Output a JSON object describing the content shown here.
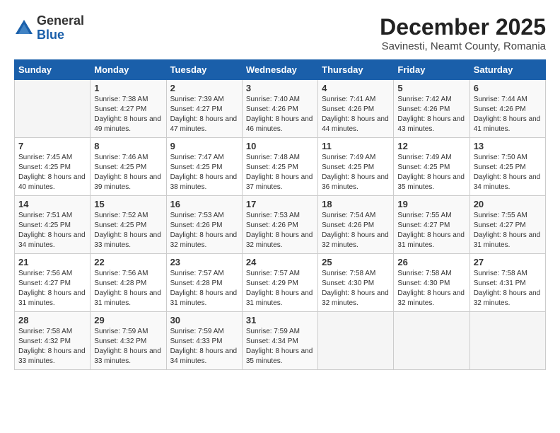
{
  "header": {
    "logo": {
      "general": "General",
      "blue": "Blue"
    },
    "month": "December 2025",
    "location": "Savinesti, Neamt County, Romania"
  },
  "days_of_week": [
    "Sunday",
    "Monday",
    "Tuesday",
    "Wednesday",
    "Thursday",
    "Friday",
    "Saturday"
  ],
  "weeks": [
    [
      {
        "day": "",
        "sunrise": "",
        "sunset": "",
        "daylight": ""
      },
      {
        "day": "1",
        "sunrise": "Sunrise: 7:38 AM",
        "sunset": "Sunset: 4:27 PM",
        "daylight": "Daylight: 8 hours and 49 minutes."
      },
      {
        "day": "2",
        "sunrise": "Sunrise: 7:39 AM",
        "sunset": "Sunset: 4:27 PM",
        "daylight": "Daylight: 8 hours and 47 minutes."
      },
      {
        "day": "3",
        "sunrise": "Sunrise: 7:40 AM",
        "sunset": "Sunset: 4:26 PM",
        "daylight": "Daylight: 8 hours and 46 minutes."
      },
      {
        "day": "4",
        "sunrise": "Sunrise: 7:41 AM",
        "sunset": "Sunset: 4:26 PM",
        "daylight": "Daylight: 8 hours and 44 minutes."
      },
      {
        "day": "5",
        "sunrise": "Sunrise: 7:42 AM",
        "sunset": "Sunset: 4:26 PM",
        "daylight": "Daylight: 8 hours and 43 minutes."
      },
      {
        "day": "6",
        "sunrise": "Sunrise: 7:44 AM",
        "sunset": "Sunset: 4:26 PM",
        "daylight": "Daylight: 8 hours and 41 minutes."
      }
    ],
    [
      {
        "day": "7",
        "sunrise": "Sunrise: 7:45 AM",
        "sunset": "Sunset: 4:25 PM",
        "daylight": "Daylight: 8 hours and 40 minutes."
      },
      {
        "day": "8",
        "sunrise": "Sunrise: 7:46 AM",
        "sunset": "Sunset: 4:25 PM",
        "daylight": "Daylight: 8 hours and 39 minutes."
      },
      {
        "day": "9",
        "sunrise": "Sunrise: 7:47 AM",
        "sunset": "Sunset: 4:25 PM",
        "daylight": "Daylight: 8 hours and 38 minutes."
      },
      {
        "day": "10",
        "sunrise": "Sunrise: 7:48 AM",
        "sunset": "Sunset: 4:25 PM",
        "daylight": "Daylight: 8 hours and 37 minutes."
      },
      {
        "day": "11",
        "sunrise": "Sunrise: 7:49 AM",
        "sunset": "Sunset: 4:25 PM",
        "daylight": "Daylight: 8 hours and 36 minutes."
      },
      {
        "day": "12",
        "sunrise": "Sunrise: 7:49 AM",
        "sunset": "Sunset: 4:25 PM",
        "daylight": "Daylight: 8 hours and 35 minutes."
      },
      {
        "day": "13",
        "sunrise": "Sunrise: 7:50 AM",
        "sunset": "Sunset: 4:25 PM",
        "daylight": "Daylight: 8 hours and 34 minutes."
      }
    ],
    [
      {
        "day": "14",
        "sunrise": "Sunrise: 7:51 AM",
        "sunset": "Sunset: 4:25 PM",
        "daylight": "Daylight: 8 hours and 34 minutes."
      },
      {
        "day": "15",
        "sunrise": "Sunrise: 7:52 AM",
        "sunset": "Sunset: 4:25 PM",
        "daylight": "Daylight: 8 hours and 33 minutes."
      },
      {
        "day": "16",
        "sunrise": "Sunrise: 7:53 AM",
        "sunset": "Sunset: 4:26 PM",
        "daylight": "Daylight: 8 hours and 32 minutes."
      },
      {
        "day": "17",
        "sunrise": "Sunrise: 7:53 AM",
        "sunset": "Sunset: 4:26 PM",
        "daylight": "Daylight: 8 hours and 32 minutes."
      },
      {
        "day": "18",
        "sunrise": "Sunrise: 7:54 AM",
        "sunset": "Sunset: 4:26 PM",
        "daylight": "Daylight: 8 hours and 32 minutes."
      },
      {
        "day": "19",
        "sunrise": "Sunrise: 7:55 AM",
        "sunset": "Sunset: 4:27 PM",
        "daylight": "Daylight: 8 hours and 31 minutes."
      },
      {
        "day": "20",
        "sunrise": "Sunrise: 7:55 AM",
        "sunset": "Sunset: 4:27 PM",
        "daylight": "Daylight: 8 hours and 31 minutes."
      }
    ],
    [
      {
        "day": "21",
        "sunrise": "Sunrise: 7:56 AM",
        "sunset": "Sunset: 4:27 PM",
        "daylight": "Daylight: 8 hours and 31 minutes."
      },
      {
        "day": "22",
        "sunrise": "Sunrise: 7:56 AM",
        "sunset": "Sunset: 4:28 PM",
        "daylight": "Daylight: 8 hours and 31 minutes."
      },
      {
        "day": "23",
        "sunrise": "Sunrise: 7:57 AM",
        "sunset": "Sunset: 4:28 PM",
        "daylight": "Daylight: 8 hours and 31 minutes."
      },
      {
        "day": "24",
        "sunrise": "Sunrise: 7:57 AM",
        "sunset": "Sunset: 4:29 PM",
        "daylight": "Daylight: 8 hours and 31 minutes."
      },
      {
        "day": "25",
        "sunrise": "Sunrise: 7:58 AM",
        "sunset": "Sunset: 4:30 PM",
        "daylight": "Daylight: 8 hours and 32 minutes."
      },
      {
        "day": "26",
        "sunrise": "Sunrise: 7:58 AM",
        "sunset": "Sunset: 4:30 PM",
        "daylight": "Daylight: 8 hours and 32 minutes."
      },
      {
        "day": "27",
        "sunrise": "Sunrise: 7:58 AM",
        "sunset": "Sunset: 4:31 PM",
        "daylight": "Daylight: 8 hours and 32 minutes."
      }
    ],
    [
      {
        "day": "28",
        "sunrise": "Sunrise: 7:58 AM",
        "sunset": "Sunset: 4:32 PM",
        "daylight": "Daylight: 8 hours and 33 minutes."
      },
      {
        "day": "29",
        "sunrise": "Sunrise: 7:59 AM",
        "sunset": "Sunset: 4:32 PM",
        "daylight": "Daylight: 8 hours and 33 minutes."
      },
      {
        "day": "30",
        "sunrise": "Sunrise: 7:59 AM",
        "sunset": "Sunset: 4:33 PM",
        "daylight": "Daylight: 8 hours and 34 minutes."
      },
      {
        "day": "31",
        "sunrise": "Sunrise: 7:59 AM",
        "sunset": "Sunset: 4:34 PM",
        "daylight": "Daylight: 8 hours and 35 minutes."
      },
      {
        "day": "",
        "sunrise": "",
        "sunset": "",
        "daylight": ""
      },
      {
        "day": "",
        "sunrise": "",
        "sunset": "",
        "daylight": ""
      },
      {
        "day": "",
        "sunrise": "",
        "sunset": "",
        "daylight": ""
      }
    ]
  ]
}
